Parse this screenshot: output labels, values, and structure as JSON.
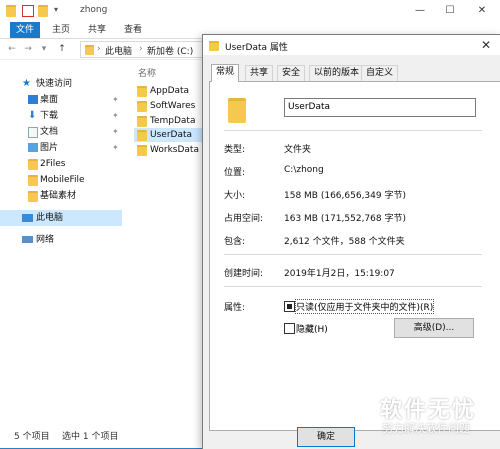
{
  "explorer": {
    "title": "zhong",
    "ribbon_tabs": [
      "文件",
      "主页",
      "共享",
      "查看"
    ],
    "breadcrumb": [
      "此电脑",
      "新加卷 (C:)"
    ],
    "nav": [
      {
        "label": "快速访问"
      },
      {
        "label": "桌面"
      },
      {
        "label": "下载"
      },
      {
        "label": "文档"
      },
      {
        "label": "图片"
      },
      {
        "label": "2Files"
      },
      {
        "label": "MobileFile"
      },
      {
        "label": "基础素材"
      },
      {
        "label": "此电脑"
      },
      {
        "label": "网络"
      }
    ],
    "column_name": "名称",
    "files": [
      "AppData",
      "SoftWares",
      "TempData",
      "UserData",
      "WorksData"
    ],
    "status": {
      "count": "5 个项目",
      "selected": "选中 1 个项目"
    }
  },
  "dialog": {
    "title": "UserData 属性",
    "tabs": [
      "常规",
      "共享",
      "安全",
      "以前的版本",
      "自定义"
    ],
    "name_value": "UserData",
    "rows": [
      {
        "label": "类型:",
        "value": "文件夹"
      },
      {
        "label": "位置:",
        "value": "C:\\zhong"
      },
      {
        "label": "大小:",
        "value": "158 MB (166,656,349 字节)"
      },
      {
        "label": "占用空间:",
        "value": "163 MB (171,552,768 字节)"
      },
      {
        "label": "包含:",
        "value": "2,612 个文件，588 个文件夹"
      },
      {
        "label": "创建时间:",
        "value": "2019年1月2日，15:19:07"
      }
    ],
    "attributes_label": "属性:",
    "readonly_label": "只读(仅应用于文件夹中的文件)(R)",
    "hidden_label": "隐藏(H)",
    "advanced_button": "高级(D)...",
    "ok_button": "确定"
  },
  "watermark": {
    "line1": "软件无忧",
    "line2": "努力解决软件问题"
  },
  "colors": {
    "accent": "#1979ca",
    "folder": "#f4c94e",
    "selection": "#cce8ff"
  }
}
